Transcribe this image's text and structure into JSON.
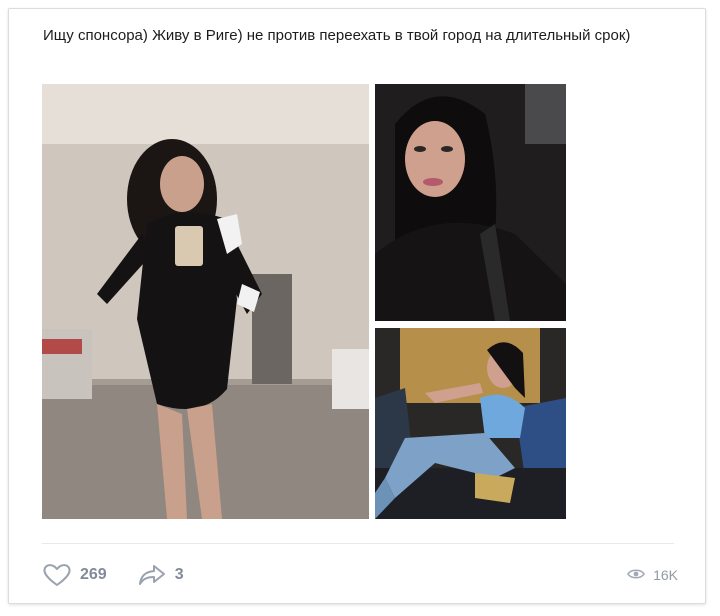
{
  "post": {
    "text": "Ищу спонсора) Живу в Риге) не против переехать в твой город на длительный срок)"
  },
  "photos": [
    {
      "icon": "photo-woman-mirror-selfie"
    },
    {
      "icon": "photo-woman-car-selfie"
    },
    {
      "icon": "photo-woman-on-sofa"
    }
  ],
  "footer": {
    "likes": "269",
    "shares": "3",
    "views": "16K"
  },
  "colors": {
    "text": "#1c1c1c",
    "icon": "#828a99",
    "divider": "#e7e8ec"
  }
}
